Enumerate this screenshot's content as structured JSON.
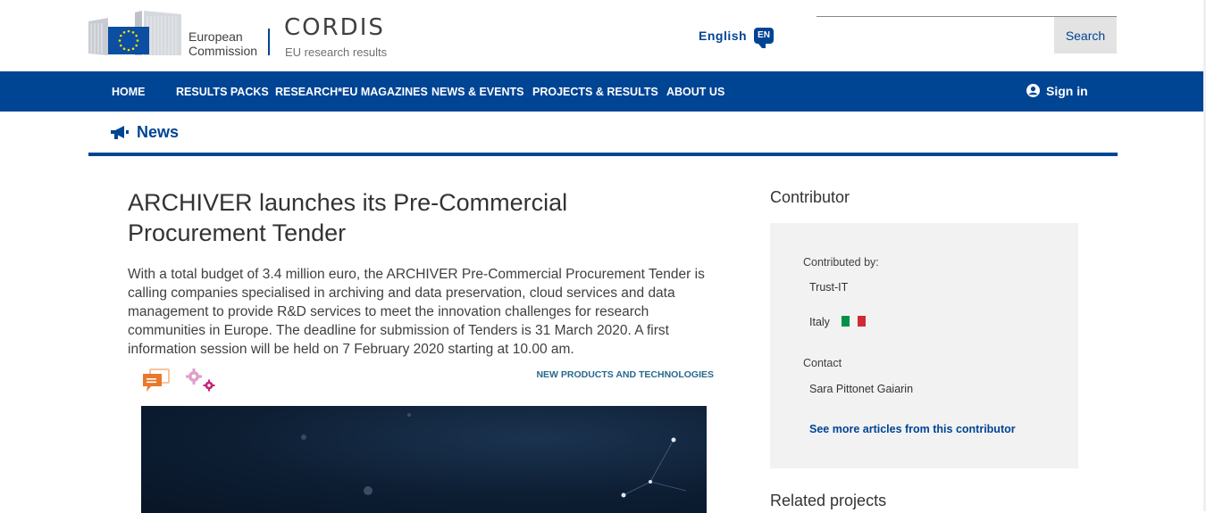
{
  "header": {
    "ec_line1": "European",
    "ec_line2": "Commission",
    "cordis_title": "CORDIS",
    "cordis_subtitle": "EU research results",
    "language": "English",
    "language_code": "EN",
    "search_placeholder": "",
    "search_button": "Search"
  },
  "nav": {
    "items": [
      "HOME",
      "RESULTS PACKS",
      "RESEARCH*EU MAGAZINES",
      "NEWS & EVENTS",
      "PROJECTS & RESULTS",
      "ABOUT US"
    ],
    "signin": "Sign in"
  },
  "section": {
    "title": "News"
  },
  "article": {
    "title": "ARCHIVER launches its Pre-Commercial Procurement Tender",
    "body": "With a total budget of 3.4 million euro, the ARCHIVER Pre-Commercial Procurement Tender is calling companies specialised in archiving and data preservation, cloud services and data management to provide R&D services to meet the innovation challenges for research communities in Europe. The deadline for submission of Tenders is 31 March 2020. A first information session will be held on 7 February 2020 starting at 10.00 am.",
    "category": "NEW PRODUCTS AND TECHNOLOGIES"
  },
  "sidebar": {
    "contributor_heading": "Contributor",
    "contributed_by_label": "Contributed by:",
    "contributor_name": "Trust-IT",
    "country": "Italy",
    "contact_label": "Contact",
    "contact_name": "Sara Pittonet Gaiarin",
    "more_link": "See more articles from this contributor",
    "related_heading": "Related projects"
  },
  "colors": {
    "brand_blue": "#004494",
    "category_teal": "#27698d",
    "chat_orange": "#e8782b",
    "gear_pink": "#e0a0c8",
    "gear_magenta": "#c2267a"
  },
  "icons": [
    "eu-flag-icon",
    "language-bubble-icon",
    "user-icon",
    "megaphone-icon",
    "chat-icon",
    "gears-icon",
    "italy-flag-icon"
  ]
}
